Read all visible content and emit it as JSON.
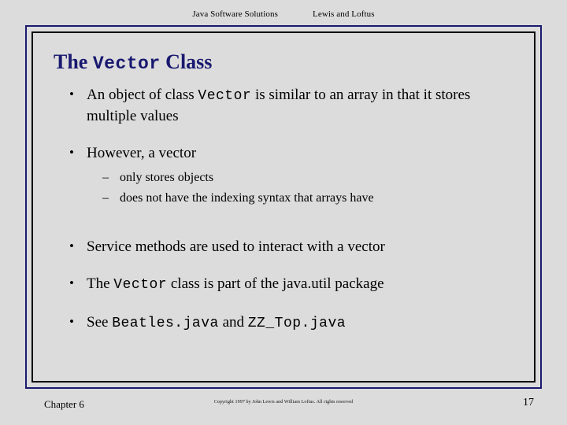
{
  "header": {
    "left": "Java Software Solutions",
    "right": "Lewis and Loftus"
  },
  "slide": {
    "title_prefix": "The ",
    "title_code": "Vector",
    "title_suffix": " Class",
    "bullet_marker": "•",
    "dash_marker": "–",
    "bullets": [
      {
        "part1": "An object of class ",
        "code": "Vector",
        "part2": " is similar to an array in that it stores multiple values"
      },
      {
        "part1": "However, a vector",
        "code": "",
        "part2": "",
        "sub": [
          "only stores objects",
          "does not have the indexing syntax that arrays have"
        ]
      },
      {
        "part1": "Service methods are used to interact with a vector",
        "code": "",
        "part2": ""
      },
      {
        "part1": "The ",
        "code": "Vector",
        "part2": " class is part of the java.util package"
      },
      {
        "part1": "See ",
        "code": "Beatles.java",
        "part2": " and ",
        "code2": "ZZ_Top.java"
      }
    ]
  },
  "footer": {
    "chapter": "Chapter 6",
    "copyright": "Copyright 1997 by John Lewis and William Loftus.  All rights reserved",
    "page_number": "17"
  },
  "colors": {
    "background": "#dcdcdc",
    "title": "#191970",
    "outer_border": "#1a1a6e",
    "inner_border": "#000000",
    "text": "#000000"
  }
}
